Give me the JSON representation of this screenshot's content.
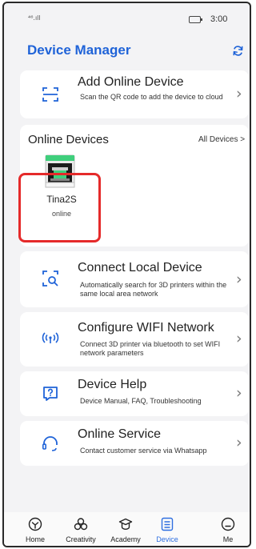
{
  "status_bar": {
    "signal": "⁴⁶.ıll",
    "time": "3:00"
  },
  "header": {
    "title": "Device Manager",
    "refresh_icon": "refresh-icon"
  },
  "add_device": {
    "title": "Add Online Device",
    "description": "Scan the QR code to add the device to cloud",
    "icon": "scan-icon"
  },
  "online_devices": {
    "title": "Online Devices",
    "all_link": "All Devices >",
    "devices": [
      {
        "name": "Tina2S",
        "status": "online"
      }
    ]
  },
  "actions": [
    {
      "title": "Connect Local Device",
      "description": "Automatically search for 3D printers within the same local area network",
      "icon": "local-search-icon"
    },
    {
      "title": "Configure WIFI Network",
      "description": "Connect 3D printer via bluetooth to set WIFI network parameters",
      "icon": "wifi-icon"
    },
    {
      "title": "Device Help",
      "description": "Device Manual, FAQ, Troubleshooting",
      "icon": "help-icon"
    },
    {
      "title": "Online Service",
      "description": "Contact customer service via Whatsapp",
      "icon": "headset-icon"
    }
  ],
  "tabs": [
    {
      "label": "Home",
      "icon": "home-icon"
    },
    {
      "label": "Creativity",
      "icon": "creativity-icon"
    },
    {
      "label": "Academy",
      "icon": "academy-icon"
    },
    {
      "label": "Device",
      "icon": "device-icon",
      "active": true
    },
    {
      "label": "Me",
      "icon": "profile-icon"
    }
  ],
  "colors": {
    "accent": "#1f63d8",
    "highlight": "#e52a2a",
    "background": "#f3f3f5"
  }
}
